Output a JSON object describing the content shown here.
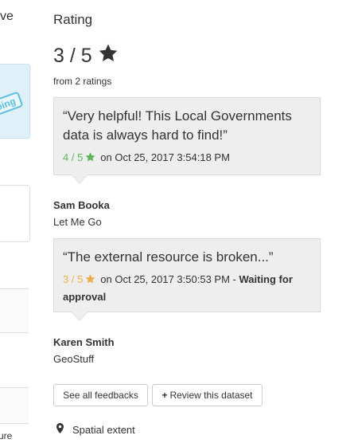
{
  "left_column": {
    "title_fragment": "ve",
    "status_stamp": "on going",
    "footer_fragment": "ure"
  },
  "rating": {
    "heading": "Rating",
    "score": "3 / 5",
    "count_text": "from 2 ratings",
    "star_icon": "star-icon"
  },
  "reviews": [
    {
      "quote": "“Very helpful! This Local Governments data is always hard to find!”",
      "score": "4 / 5",
      "score_color": "#5cb85c",
      "date": "on Oct 25, 2017 3:54:18 PM",
      "waiting": "",
      "author": "Sam Booka",
      "organisation": "Let Me Go"
    },
    {
      "quote": "“The external resource is broken...”",
      "score": "3 / 5",
      "score_color": "#f0ad4e",
      "date": "on Oct 25, 2017 3:50:53 PM -",
      "waiting": "Waiting for approval",
      "author": "Karen Smith",
      "organisation": "GeoStuff"
    }
  ],
  "actions": {
    "see_all": "See all feedbacks",
    "review": "Review this dataset"
  },
  "spatial": {
    "label": "Spatial extent",
    "icon": "map-marker-icon"
  },
  "colors": {
    "review_bg": "#eeeeee",
    "text": "#333333",
    "stamp": "#5bc0de"
  }
}
